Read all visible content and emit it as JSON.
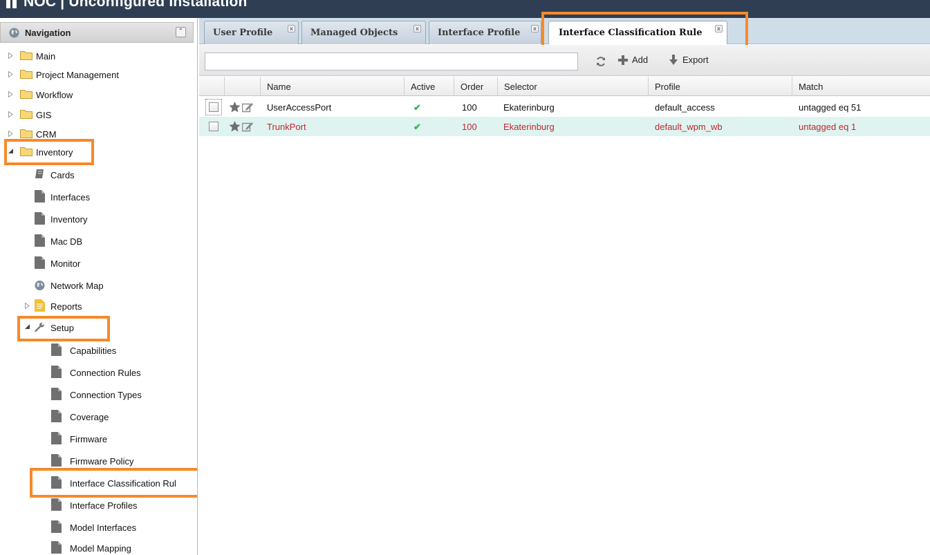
{
  "app": {
    "title": "NOC | Unconfigured Installation",
    "colors": {
      "topbar": "#2f3e52",
      "highlight": "#f7892a",
      "selected_row": "#dff3f1",
      "red_text": "#c0262d",
      "active_check": "#2fb54a"
    }
  },
  "nav": {
    "title": "Navigation",
    "items": [
      {
        "label": "Main",
        "icon": "folder-icon"
      },
      {
        "label": "Project Management",
        "icon": "folder-icon"
      },
      {
        "label": "Workflow",
        "icon": "folder-icon"
      },
      {
        "label": "GIS",
        "icon": "folder-icon"
      },
      {
        "label": "CRM",
        "icon": "folder-icon"
      },
      {
        "label": "Inventory",
        "icon": "folder-icon",
        "expanded": true
      }
    ],
    "inventory_children": [
      {
        "label": "Cards",
        "icon": "cards-icon"
      },
      {
        "label": "Interfaces",
        "icon": "document-icon"
      },
      {
        "label": "Inventory",
        "icon": "document-icon"
      },
      {
        "label": "Mac DB",
        "icon": "document-icon"
      },
      {
        "label": "Monitor",
        "icon": "document-icon"
      },
      {
        "label": "Network Map",
        "icon": "globe-icon"
      },
      {
        "label": "Reports",
        "icon": "report-icon"
      },
      {
        "label": "Setup",
        "icon": "wrench-icon",
        "expanded": true
      }
    ],
    "setup_children": [
      "Capabilities",
      "Connection Rules",
      "Connection Types",
      "Coverage",
      "Firmware",
      "Firmware Policy",
      "Interface Classification Rul",
      "Interface Profiles",
      "Model Interfaces",
      "Model Mapping"
    ]
  },
  "tabs": [
    {
      "label": "User Profile"
    },
    {
      "label": "Managed Objects"
    },
    {
      "label": "Interface Profile"
    },
    {
      "label": "Interface Classification Rule",
      "active": true
    }
  ],
  "toolbar": {
    "search_value": "",
    "add_label": "Add",
    "export_label": "Export"
  },
  "grid": {
    "columns": [
      "Name",
      "Active",
      "Order",
      "Selector",
      "Profile",
      "Match"
    ],
    "rows": [
      {
        "name": "UserAccessPort",
        "active": "✔",
        "order": "100",
        "selector": "Ekaterinburg",
        "profile": "default_access",
        "match": "untagged eq 51"
      },
      {
        "name": "TrunkPort",
        "active": "✔",
        "order": "100",
        "selector": "Ekaterinburg",
        "profile": "default_wpm_wb",
        "match": "untagged eq 1"
      }
    ]
  }
}
